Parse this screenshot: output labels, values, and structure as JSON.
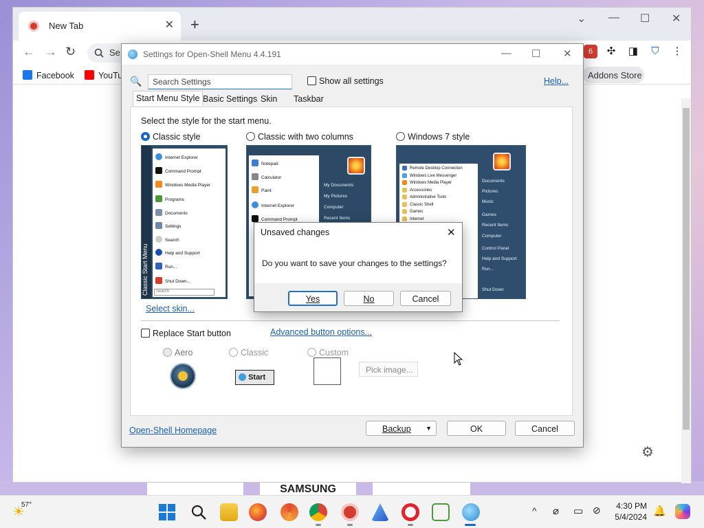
{
  "browser": {
    "tab_title": "New Tab",
    "tab_close": "✕",
    "new_tab": "+",
    "omnibox_text": "Se",
    "bookmarks": [
      "Facebook",
      "YouTu"
    ],
    "addons_store": "Addons Store",
    "window_controls": [
      "⌄",
      "—",
      "☐",
      "✕"
    ],
    "nav": {
      "back": "←",
      "forward": "→",
      "reload": "↻"
    },
    "extension_badge": "6"
  },
  "settings": {
    "title": "Settings for Open-Shell Menu 4.4.191",
    "search_placeholder": "Search Settings",
    "show_all": "Show all settings",
    "help": "Help...",
    "tabs": [
      "Start Menu Style",
      "Basic Settings",
      "Skin",
      "Taskbar"
    ],
    "select_style_text": "Select the style for the start menu.",
    "styles": [
      "Classic style",
      "Classic with two columns",
      "Windows 7 style"
    ],
    "selected_style": "Classic style",
    "select_skin": "Select skin...",
    "replace_start": "Replace Start button",
    "advanced_button": "Advanced button options...",
    "button_styles": [
      "Aero",
      "Classic",
      "Custom"
    ],
    "start_label": "Start",
    "pick_image": "Pick image...",
    "homepage": "Open-Shell Homepage",
    "backup": "Backup",
    "ok": "OK",
    "cancel": "Cancel",
    "classic_preview": {
      "side_label": "Classic Start Menu",
      "items": [
        "Internet Explorer",
        "Command Prompt",
        "Windows Media Player",
        "Programs",
        "Documents",
        "Settings",
        "Search",
        "Help and Support",
        "Run...",
        "Shut Down..."
      ],
      "search": "Search"
    },
    "two_col_preview": {
      "left": [
        "Notepad",
        "Calculator",
        "Paint",
        "Internet Explorer",
        "Command Prompt"
      ],
      "right": [
        "My Documents",
        "My Pictures",
        "Computer",
        "Recent Items"
      ]
    },
    "win7_preview": {
      "left": [
        "Remote Desktop Connection",
        "Windows Live Messenger",
        "Windows Media Player",
        "Accessories",
        "Administrative Tools",
        "Classic Shell",
        "Games",
        "Internet"
      ],
      "right": [
        "Documents",
        "Pictures",
        "Music",
        "Games",
        "Recent Items",
        "Computer",
        "Control Panel",
        "Help and Support",
        "Run..."
      ],
      "shutdown": "Shut Down"
    }
  },
  "modal": {
    "title": "Unsaved changes",
    "message": "Do you want to save your changes to the settings?",
    "yes": "Yes",
    "no": "No",
    "cancel": "Cancel"
  },
  "taskbar": {
    "weather": "57°",
    "time": "4:30 PM",
    "date": "5/4/2024",
    "chevron": "^"
  },
  "desktop": {
    "card_text": "SAMSUNG"
  }
}
